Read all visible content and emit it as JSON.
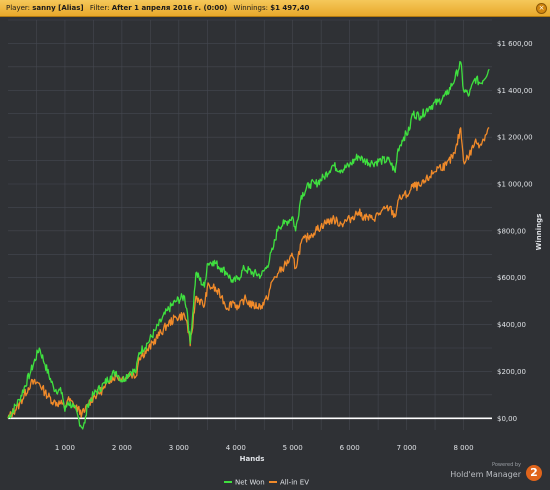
{
  "header": {
    "player_label": "Player:",
    "player_value": "sanny [Alias]",
    "filter_label": "Filter:",
    "filter_value": "After 1 апреля 2016 г. (0:00)",
    "winnings_label": "Winnings:",
    "winnings_value": "$1 497,40",
    "close_glyph": "×"
  },
  "brand": {
    "powered_by": "Powered by",
    "name": "Hold'em Manager",
    "logo_text": "2"
  },
  "colors": {
    "background": "#2f3135",
    "grid": "#454850",
    "net_won": "#3fe03f",
    "all_in_ev": "#f08a2a",
    "zero_line": "#ffffff",
    "text": "#dfe2e6"
  },
  "chart_data": {
    "type": "line",
    "xlabel": "Hands",
    "ylabel": "Winnings",
    "xlim": [
      0,
      8500
    ],
    "ylim": [
      -50,
      1700
    ],
    "x_ticks": [
      1000,
      2000,
      3000,
      4000,
      5000,
      6000,
      7000,
      8000
    ],
    "x_tick_labels": [
      "1 000",
      "2 000",
      "3 000",
      "4 000",
      "5 000",
      "6 000",
      "7 000",
      "8 000"
    ],
    "y_ticks": [
      0,
      200,
      400,
      600,
      800,
      1000,
      1200,
      1400,
      1600
    ],
    "y_tick_labels": [
      "$0,00",
      "$200,00",
      "$400,00",
      "$600,00",
      "$800,00",
      "$1 000,00",
      "$1 200,00",
      "$1 400,00",
      "$1 600,00"
    ],
    "grid": true,
    "legend_position": "bottom-center",
    "series": [
      {
        "name": "Net Won",
        "color": "#3fe03f",
        "x": [
          0,
          200,
          400,
          550,
          650,
          800,
          950,
          1000,
          1050,
          1150,
          1300,
          1350,
          1400,
          1500,
          1700,
          1800,
          1900,
          2000,
          2150,
          2250,
          2300,
          2450,
          2600,
          2800,
          2950,
          3100,
          3150,
          3200,
          3300,
          3450,
          3500,
          3600,
          3750,
          3850,
          3950,
          4050,
          4150,
          4300,
          4450,
          4550,
          4650,
          4750,
          4850,
          5000,
          5050,
          5150,
          5300,
          5400,
          5550,
          5700,
          5850,
          6000,
          6150,
          6250,
          6400,
          6550,
          6700,
          6800,
          6850,
          6950,
          7050,
          7100,
          7250,
          7400,
          7550,
          7700,
          7850,
          7950,
          8000,
          8100,
          8200,
          8300,
          8450
        ],
        "y": [
          0,
          80,
          200,
          300,
          230,
          130,
          110,
          30,
          70,
          50,
          -40,
          -20,
          60,
          100,
          150,
          180,
          200,
          160,
          200,
          200,
          280,
          320,
          380,
          460,
          500,
          520,
          450,
          320,
          620,
          560,
          660,
          670,
          640,
          620,
          580,
          600,
          640,
          620,
          610,
          650,
          720,
          820,
          830,
          860,
          800,
          950,
          1000,
          1000,
          1030,
          1080,
          1060,
          1080,
          1120,
          1100,
          1090,
          1100,
          1100,
          1050,
          1150,
          1200,
          1230,
          1300,
          1290,
          1330,
          1350,
          1380,
          1450,
          1520,
          1400,
          1380,
          1450,
          1430,
          1490
        ]
      },
      {
        "name": "All-in EV",
        "color": "#f08a2a",
        "x": [
          0,
          200,
          400,
          550,
          650,
          800,
          950,
          1000,
          1050,
          1150,
          1300,
          1350,
          1400,
          1500,
          1700,
          1800,
          1900,
          2000,
          2150,
          2250,
          2300,
          2450,
          2600,
          2800,
          2950,
          3100,
          3150,
          3200,
          3300,
          3450,
          3500,
          3600,
          3750,
          3850,
          3950,
          4050,
          4150,
          4300,
          4450,
          4550,
          4650,
          4750,
          4850,
          5000,
          5050,
          5150,
          5300,
          5400,
          5550,
          5700,
          5850,
          6000,
          6150,
          6250,
          6400,
          6550,
          6700,
          6800,
          6850,
          6950,
          7050,
          7100,
          7250,
          7400,
          7550,
          7700,
          7850,
          7950,
          8000,
          8100,
          8200,
          8300,
          8450
        ],
        "y": [
          0,
          60,
          150,
          150,
          110,
          70,
          60,
          50,
          80,
          60,
          20,
          30,
          60,
          90,
          130,
          170,
          180,
          170,
          190,
          180,
          260,
          290,
          340,
          400,
          430,
          440,
          400,
          310,
          520,
          480,
          560,
          560,
          520,
          470,
          500,
          470,
          510,
          480,
          480,
          510,
          590,
          620,
          650,
          690,
          640,
          750,
          780,
          800,
          830,
          850,
          830,
          850,
          880,
          860,
          850,
          880,
          900,
          860,
          930,
          950,
          960,
          990,
          990,
          1030,
          1070,
          1080,
          1130,
          1240,
          1100,
          1120,
          1180,
          1170,
          1240
        ]
      }
    ]
  }
}
